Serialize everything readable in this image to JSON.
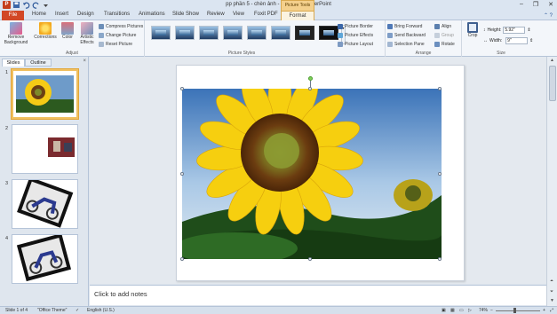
{
  "window": {
    "title": "pp phần 5 - chèn ảnh  -  Microsoft PowerPoint",
    "context_tab_header": "Picture Tools",
    "app_icon": "P"
  },
  "tabs": {
    "file": "File",
    "items": [
      "Home",
      "Insert",
      "Design",
      "Transitions",
      "Animations",
      "Slide Show",
      "Review",
      "View",
      "Foxit PDF"
    ],
    "format": "Format"
  },
  "ribbon": {
    "adjust": {
      "label": "Adjust",
      "remove_background": "Remove Background",
      "corrections": "Corrections",
      "color": "Color",
      "artistic_effects": "Artistic Effects",
      "compress": "Compress Pictures",
      "change": "Change Picture",
      "reset": "Reset Picture"
    },
    "picture_styles": {
      "label": "Picture Styles",
      "picture_border": "Picture Border",
      "picture_effects": "Picture Effects",
      "picture_layout": "Picture Layout"
    },
    "arrange": {
      "label": "Arrange",
      "bring_forward": "Bring Forward",
      "send_backward": "Send Backward",
      "selection_pane": "Selection Pane",
      "align": "Align",
      "group": "Group",
      "rotate": "Rotate"
    },
    "size": {
      "label": "Size",
      "crop": "Crop",
      "height_label": "Height:",
      "height_value": "5.92\"",
      "width_label": "Width:",
      "width_value": "9\""
    }
  },
  "panel": {
    "tab_slides": "Slides",
    "tab_outline": "Outline",
    "close": "×",
    "slides": [
      "1",
      "2",
      "3",
      "4"
    ]
  },
  "notes": {
    "placeholder": "Click to add notes"
  },
  "status": {
    "slide": "Slide 1 of 4",
    "theme": "\"Office Theme\"",
    "language": "English (U.S.)",
    "zoom": "74%"
  }
}
